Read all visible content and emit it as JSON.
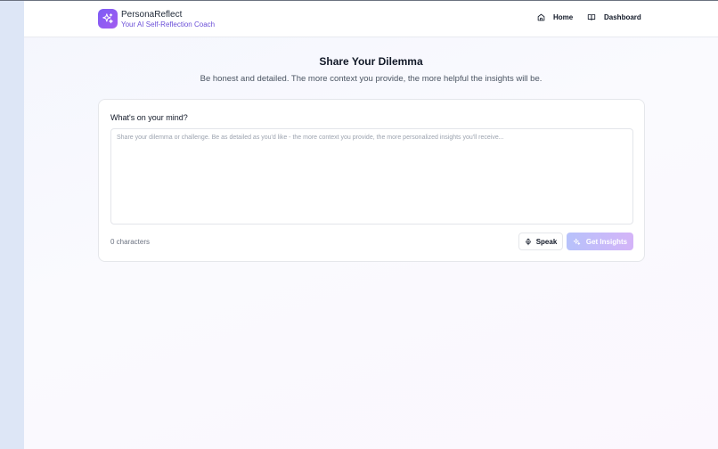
{
  "header": {
    "brand_title": "PersonaReflect",
    "brand_subtitle": "Your AI Self-Reflection Coach",
    "nav": [
      {
        "label": "Home",
        "icon": "home-icon"
      },
      {
        "label": "Dashboard",
        "icon": "book-open-icon"
      }
    ]
  },
  "main": {
    "title": "Share Your Dilemma",
    "subtitle": "Be honest and detailed. The more context you provide, the more helpful the insights will be.",
    "form": {
      "label": "What's on your mind?",
      "value": "",
      "placeholder": "Share your dilemma or challenge. Be as detailed as you'd like - the more context you provide, the more personalized insights you'll receive...",
      "char_count": "0 characters",
      "speak_label": "Speak",
      "insights_label": "Get Insights"
    }
  },
  "colors": {
    "accent": "#7c5cf5",
    "accent_secondary": "#a35cf0",
    "sidebar_strip": "#dde6f6"
  }
}
